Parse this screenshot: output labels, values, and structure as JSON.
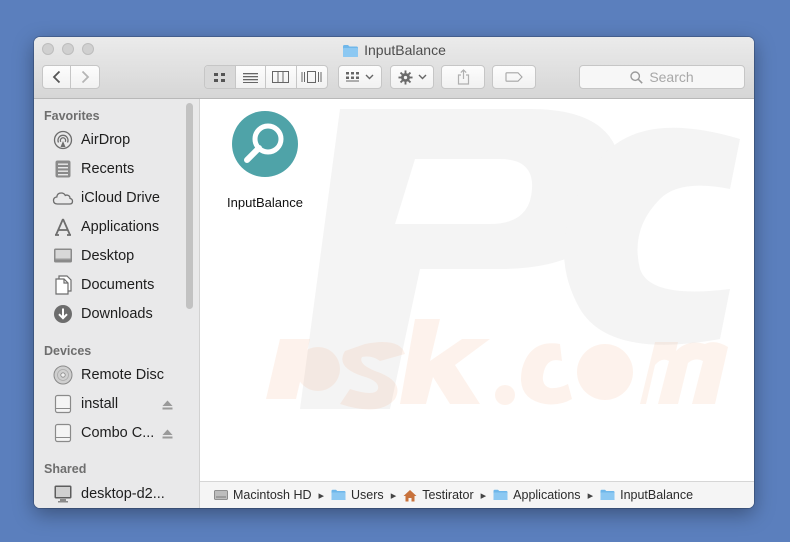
{
  "window": {
    "title": "InputBalance"
  },
  "toolbar": {
    "back_icon": "chevron-left-icon",
    "forward_icon": "chevron-right-icon",
    "view_modes": [
      "icon-view-icon",
      "list-view-icon",
      "column-view-icon",
      "cover-flow-icon"
    ],
    "search_placeholder": "Search"
  },
  "sidebar": {
    "favorites_heading": "Favorites",
    "favorites": [
      {
        "label": "AirDrop",
        "icon": "airdrop-icon"
      },
      {
        "label": "Recents",
        "icon": "recents-icon"
      },
      {
        "label": "iCloud Drive",
        "icon": "cloud-icon"
      },
      {
        "label": "Applications",
        "icon": "applications-icon"
      },
      {
        "label": "Desktop",
        "icon": "desktop-icon"
      },
      {
        "label": "Documents",
        "icon": "documents-icon"
      },
      {
        "label": "Downloads",
        "icon": "downloads-icon"
      }
    ],
    "devices_heading": "Devices",
    "devices": [
      {
        "label": "Remote Disc",
        "icon": "disc-icon"
      },
      {
        "label": "install",
        "icon": "drive-icon"
      },
      {
        "label": "Combo C...",
        "icon": "drive-icon"
      }
    ],
    "shared_heading": "Shared",
    "shared": [
      {
        "label": "desktop-d2...",
        "icon": "computer-icon"
      }
    ]
  },
  "content": {
    "items": [
      {
        "label": "InputBalance",
        "icon": "magnifier-app-icon"
      }
    ],
    "watermark": "PCrisk.com"
  },
  "pathbar": {
    "crumbs": [
      "Macintosh HD",
      "Users",
      "Testirator",
      "Applications",
      "InputBalance"
    ]
  },
  "colors": {
    "desktop_bg": "#5b7fbd",
    "app_icon_teal": "#4fa3a8",
    "folder_blue": "#6fb7ea"
  }
}
